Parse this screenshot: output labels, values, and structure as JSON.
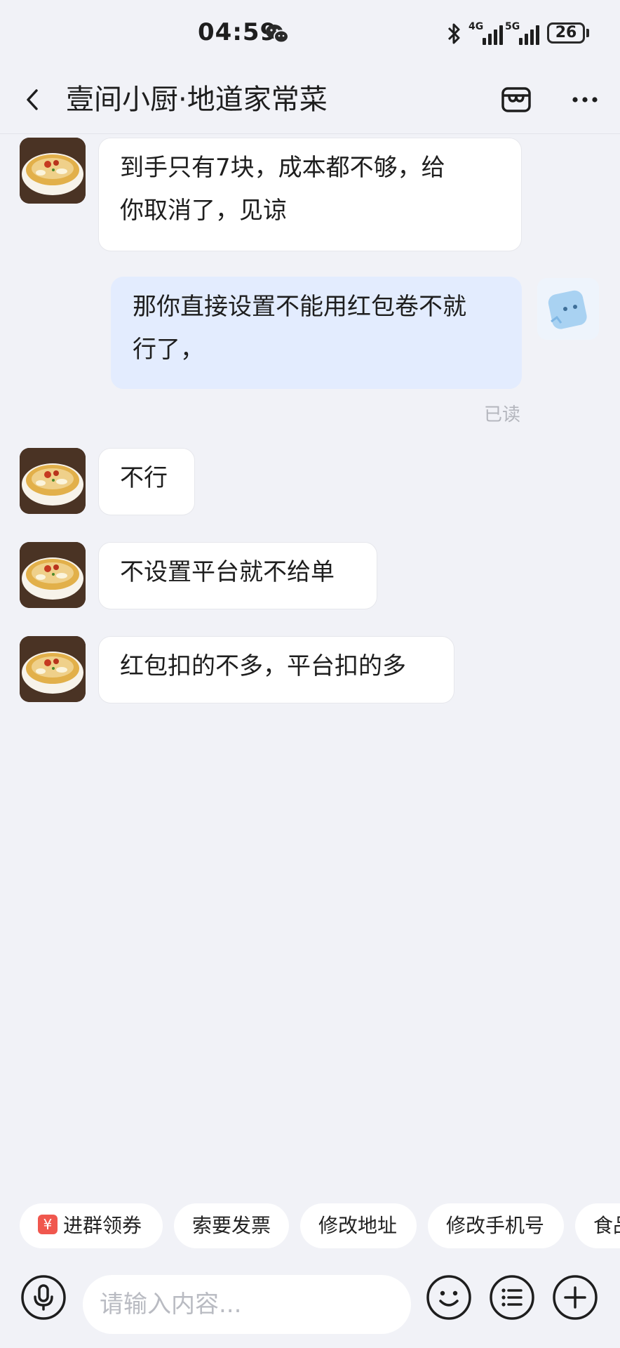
{
  "status_bar": {
    "time": "04:59",
    "network_1": "4G",
    "network_2": "5G",
    "battery": "26"
  },
  "header": {
    "title": "壹间小厨·地道家常菜"
  },
  "messages": [
    {
      "from": "shop",
      "text_lines": [
        "到手只有7块，成本都不够，给",
        "你取消了，见谅"
      ]
    },
    {
      "from": "me",
      "text_lines": [
        "那你直接设置不能用红包卷不就",
        "行了，"
      ]
    },
    {
      "from": "shop",
      "text_lines": [
        "不行"
      ]
    },
    {
      "from": "shop",
      "text_lines": [
        "不设置平台就不给单"
      ]
    },
    {
      "from": "shop",
      "text_lines": [
        "红包扣的不多，平台扣的多"
      ]
    }
  ],
  "read_status": "已读",
  "quick_actions": [
    {
      "label": "进群领券",
      "icon": "¥"
    },
    {
      "label": "索要发票"
    },
    {
      "label": "修改地址"
    },
    {
      "label": "修改手机号"
    },
    {
      "label": "食品"
    }
  ],
  "input": {
    "placeholder": "请输入内容..."
  },
  "colors": {
    "background": "#f1f2f7",
    "my_bubble": "#e3ecfe",
    "shop_bubble": "#ffffff",
    "coupon_icon": "#f0574e"
  }
}
